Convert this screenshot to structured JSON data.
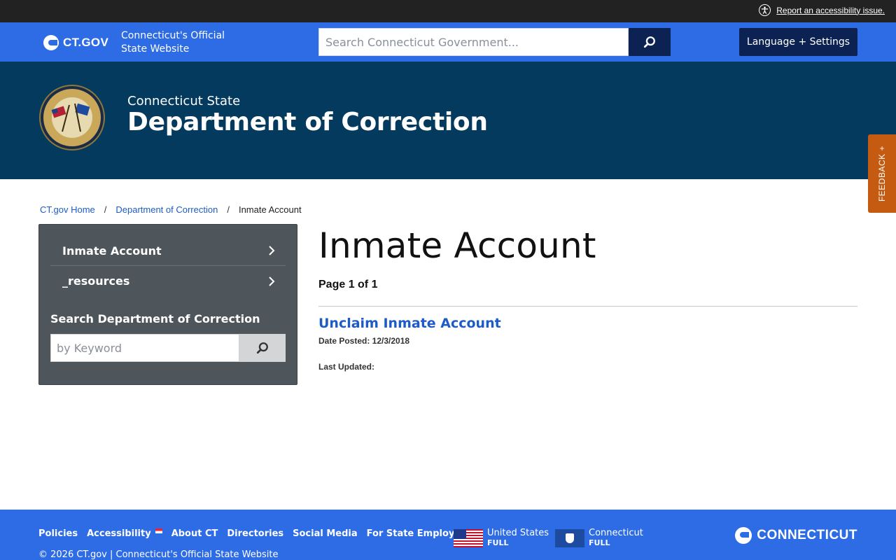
{
  "utility": {
    "accessibility_link": "Report an accessibility issue."
  },
  "header": {
    "logo_text": "CT.GOV",
    "tagline": "Connecticut's Official State Website",
    "search_placeholder": "Search Connecticut Government...",
    "language_button": "Language + Settings"
  },
  "banner": {
    "pre_title": "Connecticut State",
    "agency_name": "Department of Correction"
  },
  "feedback_label": "FEEDBACK +",
  "breadcrumb": {
    "items": [
      "CT.gov Home",
      "Department of Correction"
    ],
    "separator": "/",
    "current": "Inmate Account"
  },
  "sidebar": {
    "items": [
      {
        "label": "Inmate Account"
      },
      {
        "label": "_resources"
      }
    ],
    "search_label": "Search Department of Correction",
    "search_placeholder": "by Keyword"
  },
  "main": {
    "title": "Inmate Account",
    "page_count": "Page 1 of 1",
    "result": {
      "title": "Unclaim Inmate Account",
      "posted": "Date Posted: 12/3/2018",
      "updated": "Last Updated:"
    }
  },
  "footer": {
    "links": [
      "Policies",
      "Accessibility",
      "About CT",
      "Directories",
      "Social Media",
      "For State Employees"
    ],
    "copyright": "© 2026 CT.gov | Connecticut's Official State Website",
    "ratings": [
      {
        "label": "United States",
        "value": "FULL"
      },
      {
        "label": "Connecticut",
        "value": "FULL"
      }
    ],
    "brand": "CONNECTICUT"
  },
  "colors": {
    "gov_blue": "#2d6ce5",
    "banner_navy": "#043a5e",
    "dark_navy": "#0b2253",
    "feedback_orange": "#c55a11",
    "link_blue": "#1d5bc7",
    "sidebar_gray": "#4f565b"
  },
  "icons": [
    "accessibility-icon",
    "search-icon",
    "chevron-right-icon",
    "agency-seal"
  ]
}
